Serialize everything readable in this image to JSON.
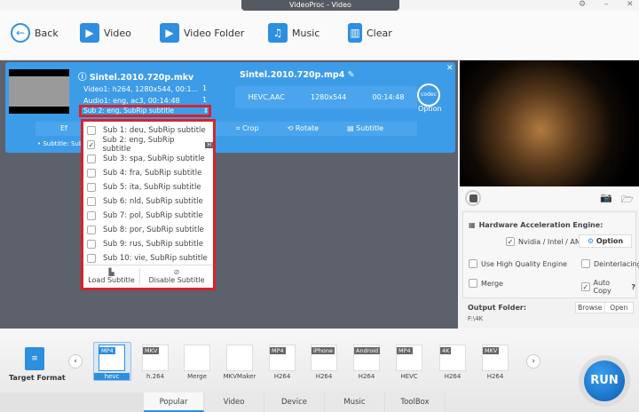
{
  "window": {
    "title": "VideoProc - Video"
  },
  "toolbar": {
    "back": "Back",
    "video": "Video",
    "video_folder": "Video Folder",
    "music": "Music",
    "clear": "Clear"
  },
  "card": {
    "source_name": "Sintel.2010.720p.mkv",
    "video_track": "Video1: h264, 1280x544, 00:1...",
    "audio_track": "Audio1: eng, ac3, 00:14:48",
    "sub_track": "Sub 2: eng, SubRip subtitle",
    "track_count_video": "1",
    "track_count_audio": "1",
    "output_name": "Sintel.2010.720p.mp4",
    "codec": "HEVC,AAC",
    "resolution": "1280x544",
    "duration": "00:14:48",
    "codec_icon": "codec",
    "option": "Option",
    "tools": {
      "effect": "Ef",
      "crop": "Crop",
      "rotate": "Rotate",
      "subtitle": "Subtitle"
    },
    "subtitle_info": "Subtitle: Sub"
  },
  "dropdown": {
    "items": [
      {
        "label": "Sub 1: deu, SubRip subtitle",
        "checked": false
      },
      {
        "label": "Sub 2: eng, SubRip subtitle",
        "checked": true,
        "badge": "H"
      },
      {
        "label": "Sub 3: spa, SubRip subtitle",
        "checked": false
      },
      {
        "label": "Sub 4: fra, SubRip subtitle",
        "checked": false
      },
      {
        "label": "Sub 5: ita, SubRip subtitle",
        "checked": false
      },
      {
        "label": "Sub 6: nld, SubRip subtitle",
        "checked": false
      },
      {
        "label": "Sub 7: pol, SubRip subtitle",
        "checked": false
      },
      {
        "label": "Sub 8: por, SubRip subtitle",
        "checked": false
      },
      {
        "label": "Sub 9: rus, SubRip subtitle",
        "checked": false
      },
      {
        "label": "Sub 10: vie, SubRip subtitle",
        "checked": false
      }
    ],
    "load": "Load Subtitle",
    "disable": "Disable Subtitle"
  },
  "settings": {
    "hw_title": "Hardware Acceleration Engine:",
    "hw_vendor": "Nvidia / Intel / AMD",
    "option": "Option",
    "high_quality": "Use High Quality Engine",
    "deinterlacing": "Deinterlacing",
    "merge": "Merge",
    "auto_copy": "Auto Copy",
    "help": "?",
    "output_folder_label": "Output Folder:",
    "output_folder": "F:\\4K",
    "browse": "Browse",
    "open": "Open"
  },
  "bottom": {
    "target_format": "Target Format",
    "run": "RUN",
    "formats": [
      {
        "tag": "MP4",
        "label": "hevc"
      },
      {
        "tag": "MKV",
        "label": "h.264"
      },
      {
        "tag": "",
        "label": "Merge"
      },
      {
        "tag": "",
        "label": "MKVMaker"
      },
      {
        "tag": "MP4",
        "label": "H264"
      },
      {
        "tag": "iPhone",
        "label": "H264"
      },
      {
        "tag": "Android",
        "label": "H264"
      },
      {
        "tag": "MP4",
        "label": "HEVC"
      },
      {
        "tag": "4K",
        "label": "H264"
      },
      {
        "tag": "MKV",
        "label": "H264"
      }
    ],
    "tabs": [
      "Popular",
      "Video",
      "Device",
      "Music",
      "ToolBox"
    ]
  }
}
